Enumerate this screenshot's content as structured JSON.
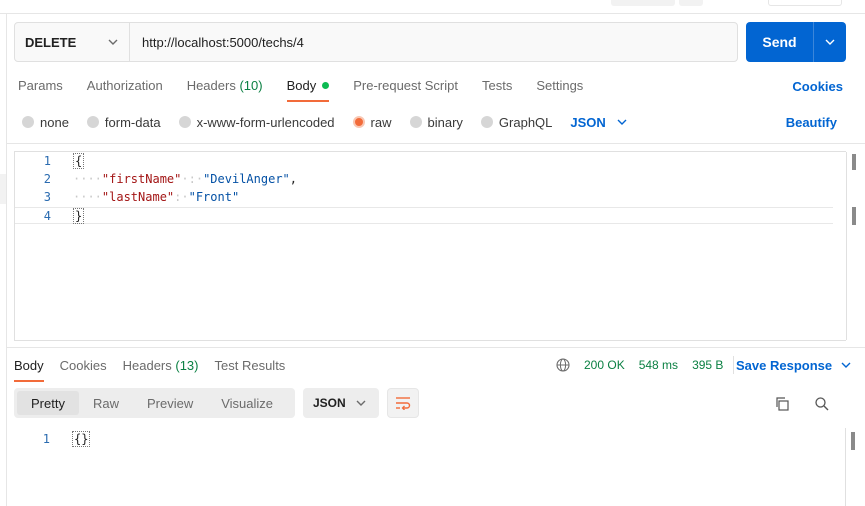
{
  "request": {
    "method": "DELETE",
    "url": "http://localhost:5000/techs/4",
    "send_label": "Send"
  },
  "request_tabs": [
    {
      "label": "Params",
      "count": null,
      "active": false
    },
    {
      "label": "Authorization",
      "count": null,
      "active": false
    },
    {
      "label": "Headers",
      "count": "(10)",
      "active": false
    },
    {
      "label": "Body",
      "count": null,
      "active": true
    },
    {
      "label": "Pre-request Script",
      "count": null,
      "active": false
    },
    {
      "label": "Tests",
      "count": null,
      "active": false
    },
    {
      "label": "Settings",
      "count": null,
      "active": false
    }
  ],
  "cookies_label": "Cookies",
  "body_types": [
    {
      "label": "none",
      "selected": false
    },
    {
      "label": "form-data",
      "selected": false
    },
    {
      "label": "x-www-form-urlencoded",
      "selected": false
    },
    {
      "label": "raw",
      "selected": true
    },
    {
      "label": "binary",
      "selected": false
    },
    {
      "label": "GraphQL",
      "selected": false
    }
  ],
  "body_language": "JSON",
  "beautify_label": "Beautify",
  "request_body": {
    "line_numbers": [
      "1",
      "2",
      "3",
      "4"
    ],
    "open_brace": "{",
    "close_brace": "}",
    "line2": {
      "indent": "····",
      "key": "\"firstName\"",
      "mid": "·:·",
      "value": "\"DevilAnger\"",
      "tail": ","
    },
    "line3": {
      "indent": "····",
      "key": "\"lastName\"",
      "mid": ":·",
      "value": "\"Front\"",
      "tail": ""
    }
  },
  "response_tabs": [
    {
      "label": "Body",
      "count": null,
      "active": true
    },
    {
      "label": "Cookies",
      "count": null,
      "active": false
    },
    {
      "label": "Headers",
      "count": "(13)",
      "active": false
    },
    {
      "label": "Test Results",
      "count": null,
      "active": false
    }
  ],
  "response_status": {
    "status": "200 OK",
    "time": "548 ms",
    "size": "395 B"
  },
  "save_response_label": "Save Response",
  "view_modes": [
    {
      "label": "Pretty",
      "active": true
    },
    {
      "label": "Raw",
      "active": false
    },
    {
      "label": "Preview",
      "active": false
    },
    {
      "label": "Visualize",
      "active": false
    }
  ],
  "response_format": "JSON",
  "response_body": {
    "line_number": "1",
    "content": "{}"
  },
  "colors": {
    "accent": "#f26b3a",
    "primary": "#0265d2",
    "success": "#0b8043"
  },
  "icons": [
    "chevron-down-icon",
    "globe-icon",
    "wrap-lines-icon",
    "copy-icon",
    "search-icon"
  ]
}
